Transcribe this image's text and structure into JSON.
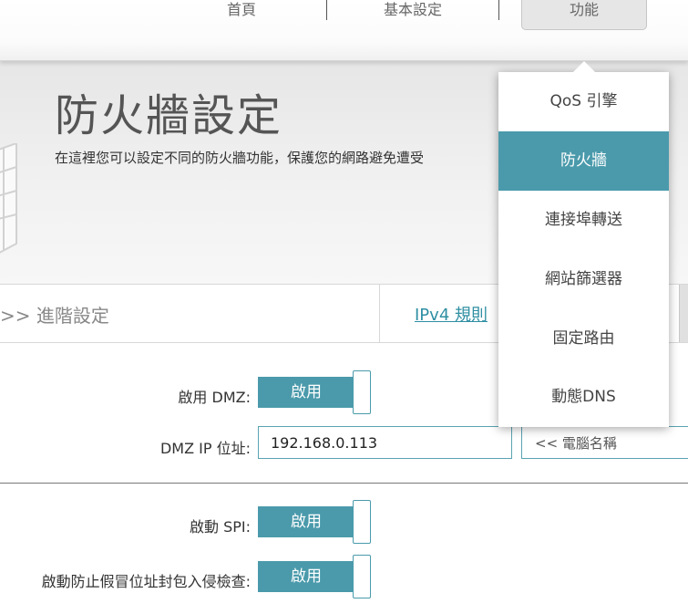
{
  "nav": {
    "home": "首頁",
    "basic": "基本設定",
    "features": "功能"
  },
  "header": {
    "title": "防火牆設定",
    "description": "在這裡您可以設定不同的防火牆功能，保護您的網路避免遭受"
  },
  "tabs": {
    "advanced": ">> 進階設定",
    "ipv4_rules": "IPv4 規則"
  },
  "form": {
    "dmz_label": "啟用 DMZ:",
    "dmz_toggle": "啟用",
    "dmz_ip_label": "DMZ IP 位址:",
    "dmz_ip_value": "192.168.0.113",
    "computer_name_select": "<< 電腦名稱",
    "spi_label": "啟動 SPI:",
    "spi_toggle": "啟用",
    "anti_spoof_label": "啟動防止假冒位址封包入侵檢查:",
    "anti_spoof_toggle": "啟用"
  },
  "menu": {
    "items": [
      {
        "label": "QoS 引擎"
      },
      {
        "label": "防火牆"
      },
      {
        "label": "連接埠轉送"
      },
      {
        "label": "網站篩選器"
      },
      {
        "label": "固定路由"
      },
      {
        "label": "動態DNS"
      }
    ],
    "active_index": 1
  },
  "colors": {
    "accent": "#4a9aab",
    "link": "#2f8fa3"
  }
}
